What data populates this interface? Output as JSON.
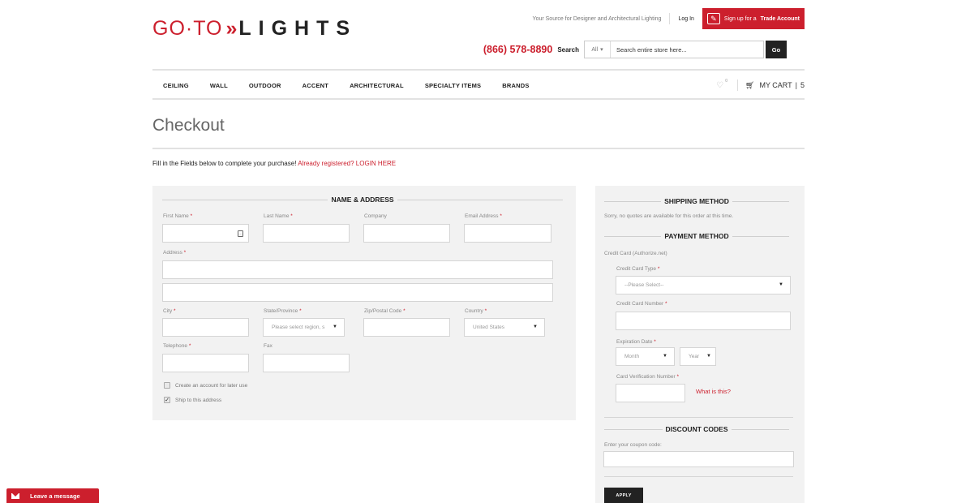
{
  "header": {
    "logo": {
      "part1": "GO·TO",
      "arrows": "»",
      "part2": "LIGHTS"
    },
    "tagline": "Your Source for Designer and Architectural Lighting",
    "login": "Log In",
    "trade_prefix": "Sign up for a",
    "trade_bold": "Trade Account",
    "phone": "(866) 578-8890",
    "search_label": "Search",
    "search_category": "All",
    "search_placeholder": "Search entire store here...",
    "go_label": "Go"
  },
  "nav": {
    "items": [
      "CEILING",
      "WALL",
      "OUTDOOR",
      "ACCENT",
      "ARCHITECTURAL",
      "SPECIALTY ITEMS",
      "BRANDS"
    ],
    "wishlist_count": "0",
    "cart_label": "MY CART",
    "cart_count": "5"
  },
  "page": {
    "title": "Checkout",
    "intro": "Fill in the Fields below to complete your purchase!",
    "login_link": "Already registered? LOGIN HERE"
  },
  "address": {
    "heading": "NAME & ADDRESS",
    "first_name": "First Name",
    "last_name": "Last Name",
    "company": "Company",
    "email": "Email Address",
    "address": "Address",
    "city": "City",
    "state": "State/Province",
    "state_placeholder": "Please select region, s",
    "zip": "Zip/Postal Code",
    "country": "Country",
    "country_value": "United States",
    "telephone": "Telephone",
    "fax": "Fax",
    "create_account": "Create an account for later use",
    "ship_to": "Ship to this address",
    "required_mark": "*"
  },
  "shipping": {
    "heading": "SHIPPING METHOD",
    "note": "Sorry, no quotes are available for this order at this time."
  },
  "payment": {
    "heading": "PAYMENT METHOD",
    "method": "Credit Card (Authorize.net)",
    "card_type": "Credit Card Type",
    "card_type_placeholder": "--Please Select--",
    "card_number": "Credit Card Number",
    "expiration": "Expiration Date",
    "month": "Month",
    "year": "Year",
    "cvn": "Card Verification Number",
    "what_is_this": "What is this?"
  },
  "discount": {
    "heading": "DISCOUNT CODES",
    "label": "Enter your coupon code:",
    "apply": "APPLY"
  },
  "chat": {
    "label": "Leave a message"
  },
  "colors": {
    "accent": "#cc1f2d",
    "panel": "#f2f2f2",
    "dark": "#222222"
  }
}
